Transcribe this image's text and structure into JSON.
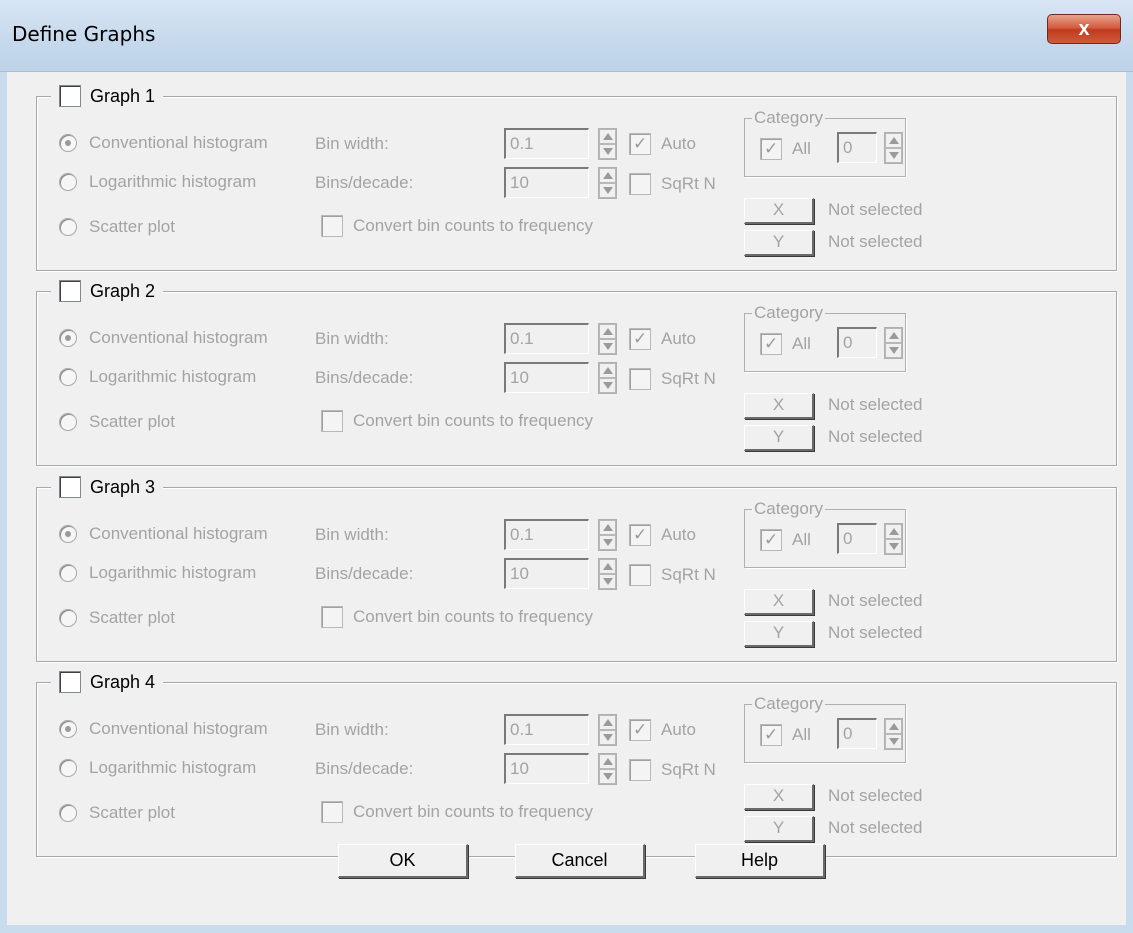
{
  "window": {
    "title": "Define Graphs",
    "close_glyph": "x"
  },
  "groups": [
    {
      "checkbox_label": "Graph 1",
      "radio_conventional": "Conventional histogram",
      "radio_logarithmic": "Logarithmic histogram",
      "radio_scatter": "Scatter plot",
      "bin_width_label": "Bin width:",
      "bin_width_value": "0.1",
      "bins_decade_label": "Bins/decade:",
      "bins_decade_value": "10",
      "auto_label": "Auto",
      "sqrtn_label": "SqRt N",
      "convert_label": "Convert bin counts to frequency",
      "category_label": "Category",
      "category_all_label": "All",
      "category_value": "0",
      "x_button": "X",
      "x_status": "Not selected",
      "y_button": "Y",
      "y_status": "Not selected"
    },
    {
      "checkbox_label": "Graph 2",
      "radio_conventional": "Conventional histogram",
      "radio_logarithmic": "Logarithmic histogram",
      "radio_scatter": "Scatter plot",
      "bin_width_label": "Bin width:",
      "bin_width_value": "0.1",
      "bins_decade_label": "Bins/decade:",
      "bins_decade_value": "10",
      "auto_label": "Auto",
      "sqrtn_label": "SqRt N",
      "convert_label": "Convert bin counts to frequency",
      "category_label": "Category",
      "category_all_label": "All",
      "category_value": "0",
      "x_button": "X",
      "x_status": "Not selected",
      "y_button": "Y",
      "y_status": "Not selected"
    },
    {
      "checkbox_label": "Graph 3",
      "radio_conventional": "Conventional histogram",
      "radio_logarithmic": "Logarithmic histogram",
      "radio_scatter": "Scatter plot",
      "bin_width_label": "Bin width:",
      "bin_width_value": "0.1",
      "bins_decade_label": "Bins/decade:",
      "bins_decade_value": "10",
      "auto_label": "Auto",
      "sqrtn_label": "SqRt N",
      "convert_label": "Convert bin counts to frequency",
      "category_label": "Category",
      "category_all_label": "All",
      "category_value": "0",
      "x_button": "X",
      "x_status": "Not selected",
      "y_button": "Y",
      "y_status": "Not selected"
    },
    {
      "checkbox_label": "Graph 4",
      "radio_conventional": "Conventional histogram",
      "radio_logarithmic": "Logarithmic histogram",
      "radio_scatter": "Scatter plot",
      "bin_width_label": "Bin width:",
      "bin_width_value": "0.1",
      "bins_decade_label": "Bins/decade:",
      "bins_decade_value": "10",
      "auto_label": "Auto",
      "sqrtn_label": "SqRt N",
      "convert_label": "Convert bin counts to frequency",
      "category_label": "Category",
      "category_all_label": "All",
      "category_value": "0",
      "x_button": "X",
      "x_status": "Not selected",
      "y_button": "Y",
      "y_status": "Not selected"
    }
  ],
  "buttons": {
    "ok": "OK",
    "cancel": "Cancel",
    "help": "Help"
  },
  "colors": {
    "titlebar": "#c7d9ec",
    "close": "#c13a1d",
    "face": "#f0f0f0",
    "disabled_text": "#a3a3a3"
  },
  "state": {
    "graph_enabled": [
      false,
      false,
      false,
      false
    ],
    "selected_type": "Conventional histogram",
    "auto_checked": true,
    "sqrtn_checked": false,
    "convert_checked": false,
    "category_all_checked": true
  }
}
